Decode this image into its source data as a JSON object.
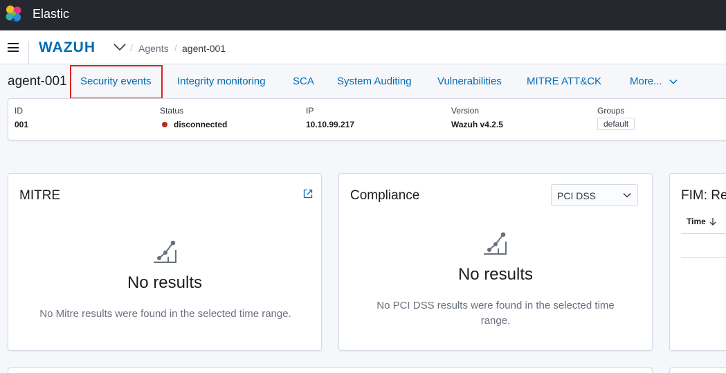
{
  "header": {
    "app_title": "Elastic",
    "logo_colors": [
      "#f0b929",
      "#2fb4a7",
      "#e6347c",
      "#2d8bd8",
      "#7ab944",
      "#1e3c78"
    ]
  },
  "breadcrumb": {
    "brand": "WAZUH",
    "items": [
      "Agents",
      "agent-001"
    ],
    "separator": "/"
  },
  "agent_tabs": {
    "agent_name": "agent-001",
    "tabs": [
      {
        "label": "Security events",
        "highlighted": true
      },
      {
        "label": "Integrity monitoring"
      },
      {
        "label": "SCA"
      },
      {
        "label": "System Auditing"
      },
      {
        "label": "Vulnerabilities"
      },
      {
        "label": "MITRE ATT&CK"
      },
      {
        "label": "More..."
      }
    ],
    "highlight_color": "#e02020"
  },
  "agent_info": {
    "id_label": "ID",
    "id_value": "001",
    "status_label": "Status",
    "status_value": "disconnected",
    "status_color": "#bd271e",
    "ip_label": "IP",
    "ip_value": "10.10.99.217",
    "version_label": "Version",
    "version_value": "Wazuh v4.2.5",
    "groups_label": "Groups",
    "group_value": "default"
  },
  "panels": {
    "mitre": {
      "title": "MITRE",
      "empty_title": "No results",
      "empty_body": "No Mitre results were found in the selected time range."
    },
    "compliance": {
      "title": "Compliance",
      "select_value": "PCI DSS",
      "empty_title": "No results",
      "empty_body": "No PCI DSS results were found in the selected time range."
    },
    "fim": {
      "title": "FIM: Rec",
      "column_header": "Time"
    }
  },
  "colors": {
    "link": "#006bb4",
    "header_bg": "#25282f"
  }
}
